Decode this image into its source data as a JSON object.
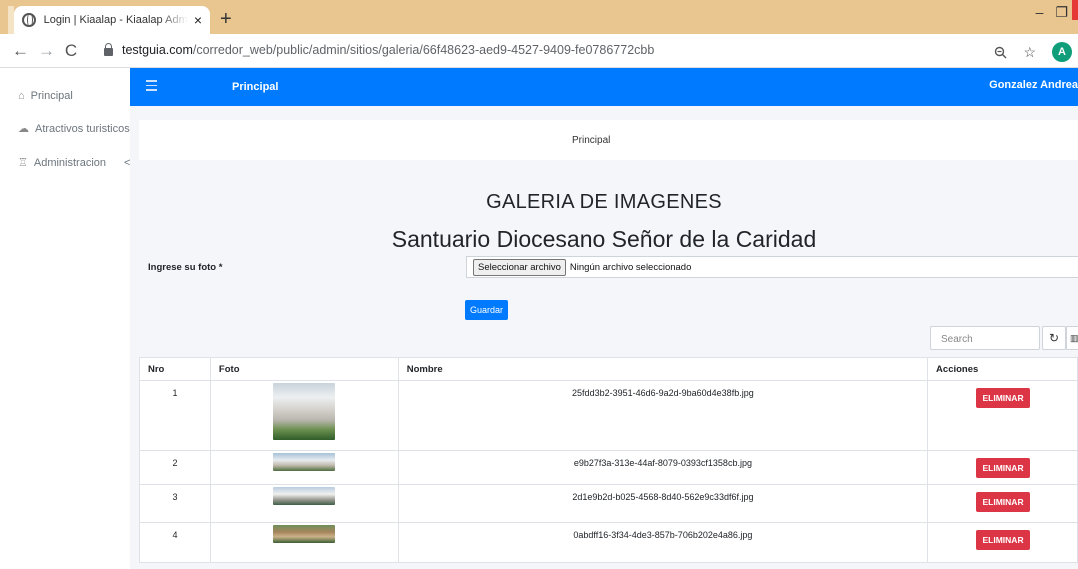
{
  "browser": {
    "tab_title": "Login | Kiaalap - Kiaalap Admin T",
    "close_glyph": "×",
    "newtab_glyph": "+",
    "url_host": "testguia.com",
    "url_path": "/corredor_web/public/admin/sitios/galeria/66f48623-aed9-4527-9409-fe0786772cbb",
    "profile_initial": "A"
  },
  "sidebar": {
    "items": [
      {
        "label": "Principal",
        "icon": "home-icon"
      },
      {
        "label": "Atractivos turisticos",
        "icon": "cloud-icon"
      },
      {
        "label": "Administracion",
        "icon": "admin-icon"
      }
    ],
    "collapse_glyph": "<"
  },
  "topnav": {
    "home_label": "Principal",
    "user_name": "Gonzalez Andrea"
  },
  "breadcrumb": {
    "label": "Principal"
  },
  "gallery": {
    "heading": "GALERIA DE IMAGENES",
    "site_name": "Santuario Diocesano Señor de la Caridad",
    "upload_label": "Ingrese su foto *",
    "file_button": "Seleccionar archivo",
    "file_status": "Ningún archivo seleccionado",
    "save_button": "Guardar"
  },
  "table": {
    "search_placeholder": "Search",
    "columns": [
      "Nro",
      "Foto",
      "Nombre",
      "Acciones"
    ],
    "delete_label": "ELIMINAR",
    "rows": [
      {
        "nro": "1",
        "nombre": "25fdd3b2-3951-46d6-9a2d-9ba60d4e38fb.jpg"
      },
      {
        "nro": "2",
        "nombre": "e9b27f3a-313e-44af-8079-0393cf1358cb.jpg"
      },
      {
        "nro": "3",
        "nombre": "2d1e9b2d-b025-4568-8d40-562e9c33df6f.jpg"
      },
      {
        "nro": "4",
        "nombre": "0abdff16-3f34-4de3-857b-706b202e4a86.jpg"
      }
    ]
  },
  "colors": {
    "primary": "#007bff",
    "danger": "#dc3545",
    "tabbar": "#e9c590"
  }
}
